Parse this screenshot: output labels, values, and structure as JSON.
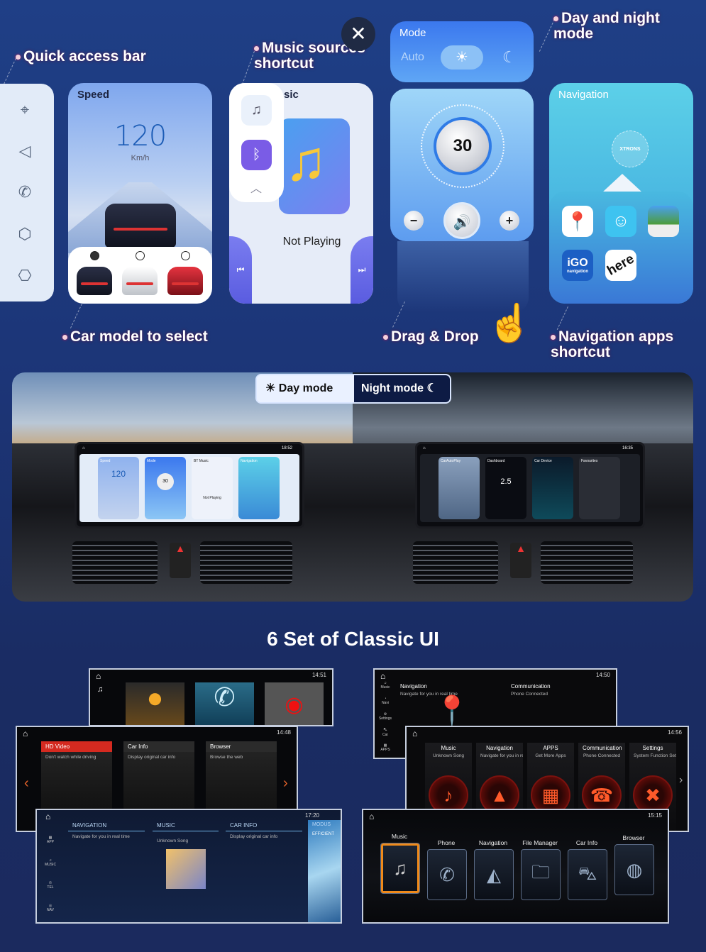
{
  "callouts": {
    "quick_access": "Quick access bar",
    "music_sources": "Music sources shortcut",
    "day_night": "Day and night mode",
    "car_model": "Car model to select",
    "drag_drop": "Drag & Drop",
    "nav_apps": "Navigation apps shortcut"
  },
  "quick_bar": {
    "icons": [
      "location-pin-icon",
      "navigation-arrow-icon",
      "phone-icon",
      "cube-icon",
      "settings-hex-icon"
    ]
  },
  "speed_card": {
    "title": "Speed",
    "value": "120",
    "unit": "Km/h",
    "car_options": 3,
    "selected_car": 1
  },
  "music_card": {
    "title": "sic",
    "status": "Not Playing",
    "sources": [
      "music-note-icon",
      "bluetooth-icon"
    ]
  },
  "mode_card": {
    "title": "Mode",
    "auto_label": "Auto",
    "selected": "day"
  },
  "volume_card": {
    "value": "30"
  },
  "navigation_card": {
    "title": "Navigation",
    "center_logo": "XTRONS",
    "apps": [
      "Google Maps",
      "Waze",
      "Sygic",
      "iGO navigation",
      "here"
    ],
    "igo_label": "iGO",
    "igo_sub": "navigation",
    "here_label": "here"
  },
  "mode_toggle": {
    "day": "Day mode",
    "night": "Night mode"
  },
  "day_screen": {
    "time": "18:52",
    "tiles": [
      "Speed",
      "Mode",
      "BT Music",
      "Navigation"
    ],
    "speed": "120",
    "volume": "30",
    "music_status": "Not Playing"
  },
  "night_screen": {
    "time": "16:35",
    "tiles": [
      "CarAutoPlay",
      "Dashboard",
      "Car Device",
      "Favourites"
    ],
    "dash_value": "2.5"
  },
  "section_title": "6 Set of Classic UI",
  "classic": {
    "ui1": {
      "time": "14:51"
    },
    "ui2": {
      "time": "14:48",
      "tiles": [
        {
          "title": "HD Video",
          "sub": "Don't watch while driving"
        },
        {
          "title": "Car Info",
          "sub": "Display original car info"
        },
        {
          "title": "Browser",
          "sub": "Browse the web"
        }
      ]
    },
    "ui3": {
      "time": "17:20",
      "side": [
        "APP",
        "MUSIC",
        "TEL",
        "NAV"
      ],
      "tiles": [
        {
          "title": "NAVIGATION",
          "sub": "Navigate for you in real time"
        },
        {
          "title": "MUSIC",
          "sub": "Unknown Song"
        },
        {
          "title": "CAR INFO",
          "sub": "Display original car info"
        },
        {
          "title": "MODUS",
          "sub": "EFFICIENT"
        }
      ]
    },
    "ui4": {
      "time": "14:50",
      "side": [
        "Music",
        "Navi",
        "Settings",
        "Car",
        "APPS"
      ],
      "tiles": [
        {
          "title": "Navigation",
          "sub": "Navigate for you in real time"
        },
        {
          "title": "Communication",
          "sub": "Phone Connected"
        }
      ]
    },
    "ui5": {
      "time": "14:56",
      "tiles": [
        {
          "title": "Music",
          "sub": "Unknown Song"
        },
        {
          "title": "Navigation",
          "sub": "Navigate for you in re..."
        },
        {
          "title": "APPS",
          "sub": "Get More Apps"
        },
        {
          "title": "Communication",
          "sub": "Phone Connected"
        },
        {
          "title": "Settings",
          "sub": "System Function Sett..."
        }
      ]
    },
    "ui6": {
      "time": "15:15",
      "tiles": [
        "Music",
        "Phone",
        "Navigation",
        "File Manager",
        "Car Info",
        "Browser"
      ]
    }
  },
  "colors": {
    "accent_red": "#e0302a",
    "night_blue": "#0d1b44",
    "bg_blue": "#1c3577"
  }
}
